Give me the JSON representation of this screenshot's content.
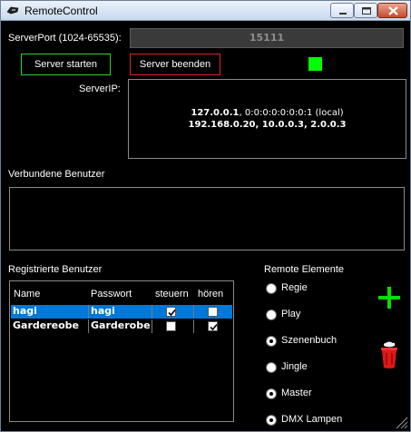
{
  "window": {
    "title": "RemoteControl",
    "buttons": [
      "minimize-icon",
      "maximize-icon",
      "close-icon"
    ]
  },
  "server": {
    "port_label": "ServerPort (1024-65535):",
    "port_value": "15111",
    "start_label": "Server starten",
    "stop_label": "Server beenden",
    "status_color": "#00ff00",
    "ip_label": "ServerIP:",
    "ip_line1_bold": "127.0.0.1",
    "ip_line1_rest": ", 0:0:0:0:0:0:0:1 (local)",
    "ip_line2": "192.168.0.20, 10.0.0.3, 2.0.0.3"
  },
  "connected": {
    "label": "Verbundene Benutzer"
  },
  "registered": {
    "label": "Registrierte Benutzer",
    "columns": [
      "Name",
      "Passwort",
      "steuern",
      "hören"
    ],
    "rows": [
      {
        "name": "hagi",
        "password": "hagi",
        "steuern": true,
        "hoeren": false,
        "selected": true
      },
      {
        "name": "Gardereobe",
        "password": "Garderobe",
        "steuern": false,
        "hoeren": true,
        "selected": false
      }
    ]
  },
  "remote": {
    "label": "Remote Elemente",
    "items": [
      {
        "label": "Regie",
        "dot": false
      },
      {
        "label": "Play",
        "dot": false
      },
      {
        "label": "Szenenbuch",
        "dot": true
      },
      {
        "label": "Jingle",
        "dot": false
      },
      {
        "label": "Master",
        "dot": true
      },
      {
        "label": "DMX Lampen",
        "dot": true
      }
    ],
    "add_icon": "plus-icon",
    "delete_icon": "trash-icon"
  },
  "colors": {
    "accent_green": "#00ff00",
    "start_border": "#2fd12f",
    "stop_border": "#e02222",
    "selection": "#0078d7",
    "trash": "#e01818"
  }
}
